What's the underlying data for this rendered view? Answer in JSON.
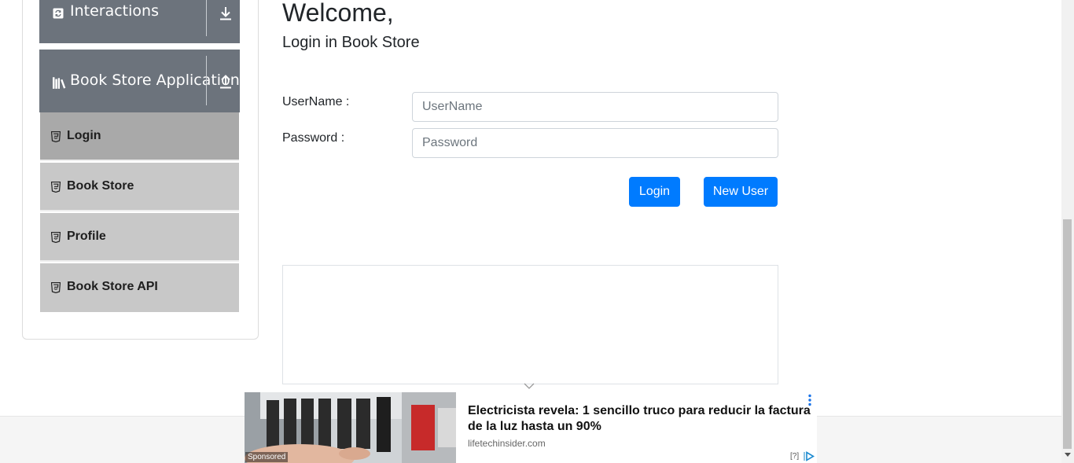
{
  "sidebar": {
    "groups": [
      {
        "label": "Interactions",
        "icon": "refresh-icon",
        "arrow": "download-arrow-icon"
      },
      {
        "label": "Book Store Application",
        "icon": "books-icon",
        "arrow": "upload-arrow-icon"
      }
    ],
    "items": [
      {
        "label": "Login",
        "icon": "html5-icon",
        "active": true
      },
      {
        "label": "Book Store",
        "icon": "html5-icon",
        "active": false
      },
      {
        "label": "Profile",
        "icon": "html5-icon",
        "active": false
      },
      {
        "label": "Book Store API",
        "icon": "html5-icon",
        "active": false
      }
    ]
  },
  "main": {
    "title": "Welcome,",
    "subtitle": "Login in Book Store",
    "username": {
      "label": "UserName :",
      "placeholder": "UserName",
      "value": ""
    },
    "password": {
      "label": "Password :",
      "placeholder": "Password",
      "value": ""
    },
    "login_button": "Login",
    "new_user_button": "New User"
  },
  "ad": {
    "sponsored": "Sponsored",
    "headline": "Electricista revela: 1 sencillo truco para reducir la factura de la luz hasta un 90%",
    "domain": "lifetechinsider.com",
    "help": "[?]"
  },
  "colors": {
    "sidebar_header": "#6c737c",
    "menu_item": "#c8c8c8",
    "menu_item_active": "#a9a9a9",
    "primary_button": "#007bff"
  }
}
